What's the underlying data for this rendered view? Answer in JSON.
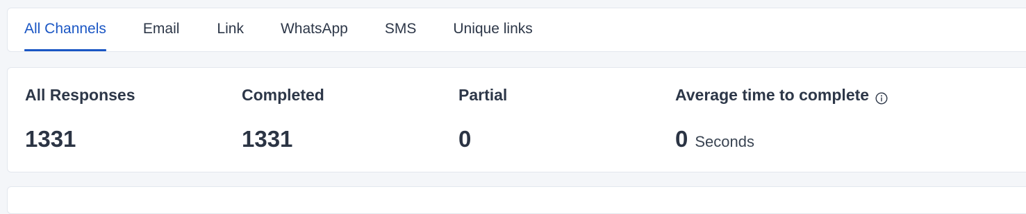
{
  "tabs": [
    {
      "label": "All Channels",
      "active": true
    },
    {
      "label": "Email",
      "active": false
    },
    {
      "label": "Link",
      "active": false
    },
    {
      "label": "WhatsApp",
      "active": false
    },
    {
      "label": "SMS",
      "active": false
    },
    {
      "label": "Unique links",
      "active": false
    }
  ],
  "stats": {
    "all_responses": {
      "label": "All Responses",
      "value": "1331"
    },
    "completed": {
      "label": "Completed",
      "value": "1331"
    },
    "partial": {
      "label": "Partial",
      "value": "0"
    },
    "avg_time": {
      "label": "Average time to complete",
      "value": "0",
      "unit": "Seconds",
      "icon": "info-icon"
    }
  },
  "colors": {
    "accent": "#1a56c4",
    "text": "#2d3748",
    "background": "#f4f6f9",
    "card": "#ffffff"
  }
}
